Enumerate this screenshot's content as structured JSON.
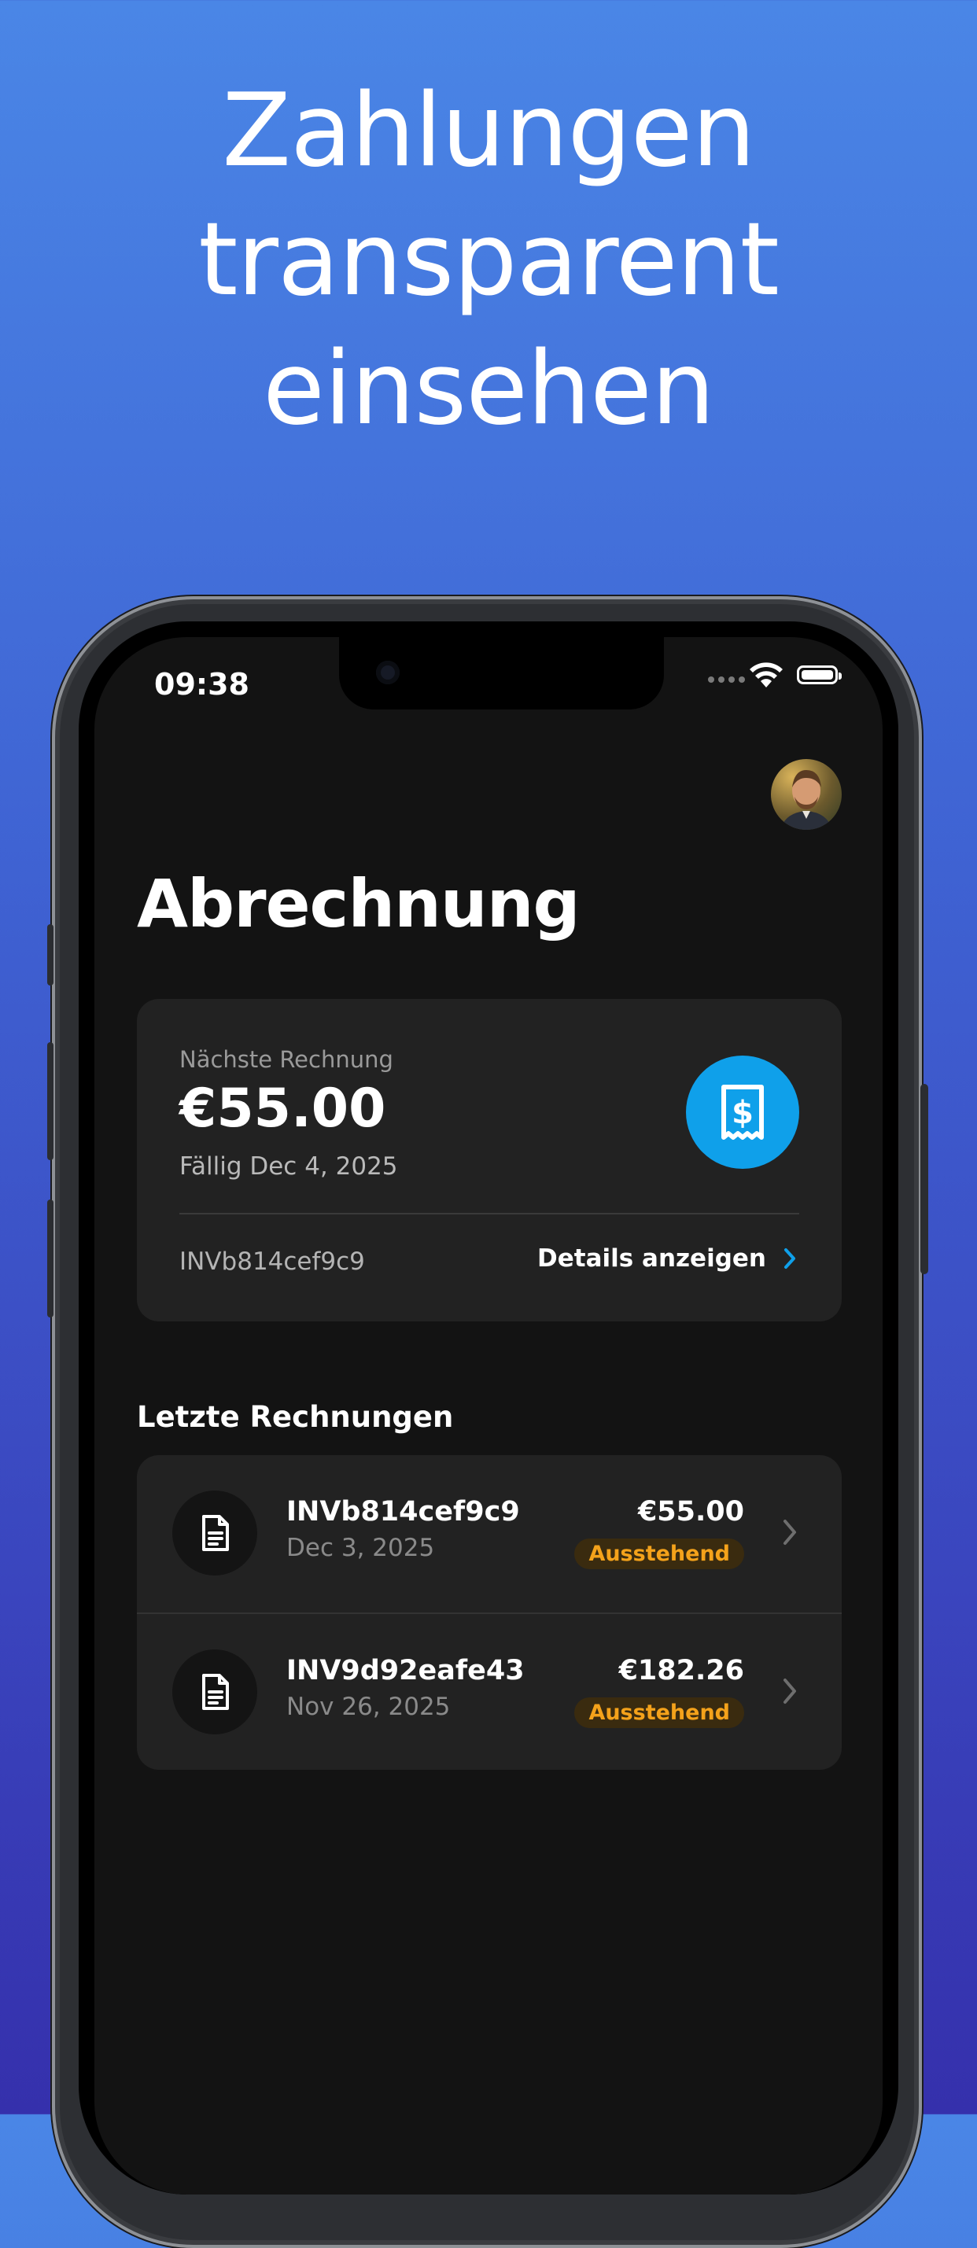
{
  "headline": {
    "line1": "Zahlungen",
    "line2": "transparent",
    "line3": "einsehen"
  },
  "status_bar": {
    "time": "09:38"
  },
  "page": {
    "title": "Abrechnung"
  },
  "next_invoice": {
    "label": "Nächste Rechnung",
    "amount": "€55.00",
    "due": "Fällig Dec 4, 2025",
    "invoice_id": "INVb814cef9c9",
    "details_label": "Details anzeigen",
    "icon": "receipt-dollar-icon"
  },
  "recent": {
    "title": "Letzte Rechnungen",
    "items": [
      {
        "id": "INVb814cef9c9",
        "date": "Dec 3, 2025",
        "amount": "€55.00",
        "status": "Ausstehend"
      },
      {
        "id": "INV9d92eafe43",
        "date": "Nov 26, 2025",
        "amount": "€182.26",
        "status": "Ausstehend"
      }
    ]
  },
  "colors": {
    "accent": "#0fa0ea",
    "status_pending": "#f4a21b",
    "card_bg": "#222222",
    "screen_bg": "#131313"
  }
}
